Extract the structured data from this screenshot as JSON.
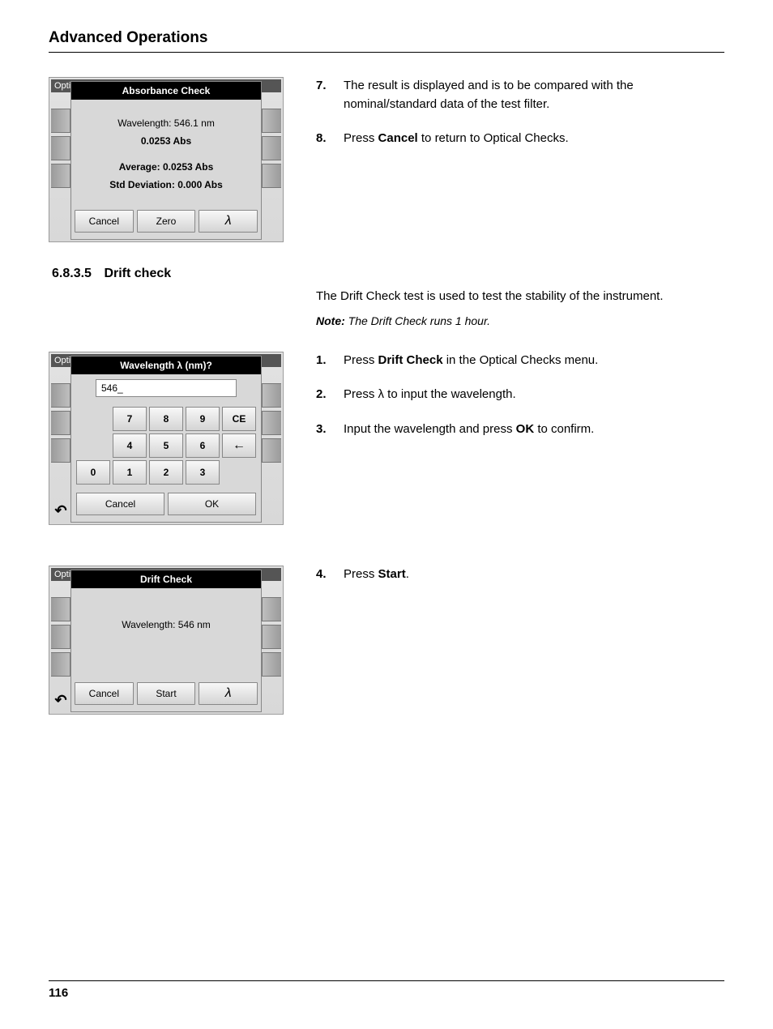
{
  "header": {
    "title": "Advanced Operations"
  },
  "screens": {
    "absorbance": {
      "bg_title": "Optical Checks",
      "title": "Absorbance Check",
      "wavelength": "Wavelength: 546.1 nm",
      "reading": "0.0253 Abs",
      "average": "Average: 0.0253 Abs",
      "stddev": "Std Deviation: 0.000 Abs",
      "btn_cancel": "Cancel",
      "btn_zero": "Zero",
      "btn_lambda": "λ"
    },
    "keypad": {
      "bg_title": "Optical Checks",
      "title": "Wavelength λ (nm)?",
      "input": "546_",
      "k7": "7",
      "k8": "8",
      "k9": "9",
      "kCE": "CE",
      "k4": "4",
      "k5": "5",
      "k6": "6",
      "k0": "0",
      "k1": "1",
      "k2": "2",
      "k3": "3",
      "btn_cancel": "Cancel",
      "btn_ok": "OK"
    },
    "drift": {
      "bg_title": "Optical Checks",
      "title": "Drift Check",
      "wavelength": "Wavelength: 546 nm",
      "btn_cancel": "Cancel",
      "btn_start": "Start",
      "btn_lambda": "λ"
    }
  },
  "steps_top": {
    "s7": {
      "num": "7.",
      "text_a": "The result is displayed and is to be compared with the nominal/standard data of the test filter."
    },
    "s8": {
      "num": "8.",
      "text_a": "Press ",
      "bold": "Cancel",
      "text_b": " to return to Optical Checks."
    }
  },
  "section": {
    "number": "6.8.3.5",
    "title": "Drift check",
    "description": "The Drift Check test is used to test the stability of the instrument.",
    "note_label": "Note:",
    "note_text": " The Drift Check runs 1 hour."
  },
  "steps_mid": {
    "s1": {
      "num": "1.",
      "text_a": "Press ",
      "bold": "Drift Check",
      "text_b": " in the Optical Checks menu."
    },
    "s2": {
      "num": "2.",
      "text_a": "Press λ to input the wavelength."
    },
    "s3": {
      "num": "3.",
      "text_a": "Input the wavelength and press ",
      "bold": "OK",
      "text_b": " to confirm."
    }
  },
  "steps_bot": {
    "s4": {
      "num": "4.",
      "text_a": "Press ",
      "bold": "Start",
      "text_b": "."
    }
  },
  "footer": {
    "page": "116"
  }
}
